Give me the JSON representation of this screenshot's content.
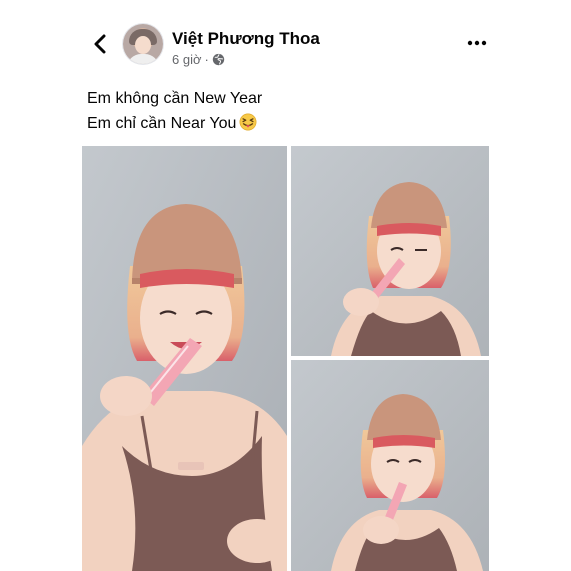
{
  "post": {
    "author": "Việt Phương Thoa",
    "time": "6 giờ",
    "separator": "·",
    "privacy_icon": "globe-icon",
    "caption_lines": [
      "Em không cần New Year",
      "Em chỉ cần Near You"
    ],
    "caption_emoji": "squinting-face-with-tongue"
  },
  "photos": [
    {
      "name": "photo-main",
      "subject": "woman-portrait"
    },
    {
      "name": "photo-top-right",
      "subject": "woman-portrait"
    },
    {
      "name": "photo-bottom-right",
      "subject": "woman-portrait"
    }
  ],
  "colors": {
    "text_primary": "#050505",
    "text_secondary": "#65676b",
    "photo_background": "#b9bec4"
  },
  "icons": {
    "back": "chevron-left-icon",
    "more": "more-horizontal-icon"
  }
}
